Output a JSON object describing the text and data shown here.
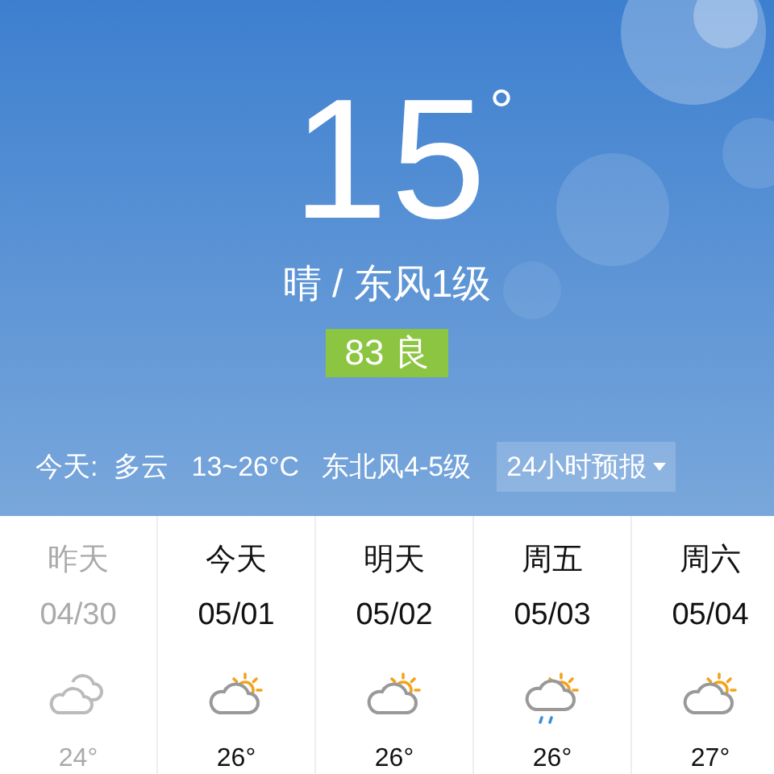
{
  "current": {
    "temperature": "15",
    "degree": "°",
    "condition": "晴 / 东风1级",
    "aqi": "83 良"
  },
  "today": {
    "label": "今天:",
    "weather": "多云",
    "range": "13~26°C",
    "wind": "东北风4-5级"
  },
  "forecast_button": {
    "label": "24小时预报"
  },
  "days": [
    {
      "day": "昨天",
      "date": "04/30",
      "kind": "cloudy",
      "temp": "24°",
      "past": true
    },
    {
      "day": "今天",
      "date": "05/01",
      "kind": "partly-cloudy",
      "temp": "26°",
      "past": false
    },
    {
      "day": "明天",
      "date": "05/02",
      "kind": "partly-cloudy",
      "temp": "26°",
      "past": false
    },
    {
      "day": "周五",
      "date": "05/03",
      "kind": "rain",
      "temp": "26°",
      "past": false
    },
    {
      "day": "周六",
      "date": "05/04",
      "kind": "partly-cloudy",
      "temp": "27°",
      "past": false
    }
  ]
}
